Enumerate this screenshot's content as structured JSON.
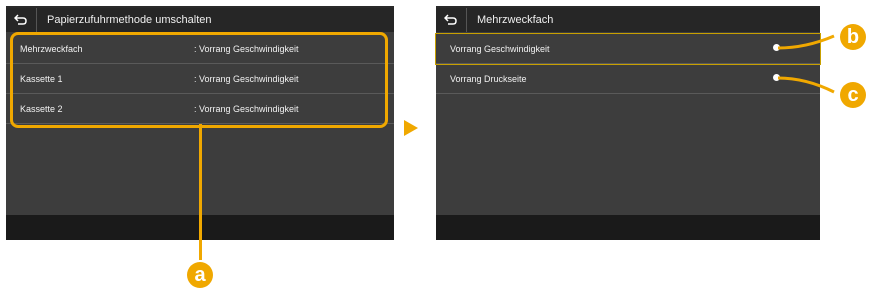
{
  "left_screen": {
    "title": "Papierzufuhrmethode umschalten",
    "rows": [
      {
        "label": "Mehrzweckfach",
        "value": ": Vorrang Geschwindigkeit"
      },
      {
        "label": "Kassette 1",
        "value": ": Vorrang Geschwindigkeit"
      },
      {
        "label": "Kassette 2",
        "value": ": Vorrang Geschwindigkeit"
      }
    ]
  },
  "right_screen": {
    "title": "Mehrzweckfach",
    "rows": [
      {
        "label": "Vorrang Geschwindigkeit"
      },
      {
        "label": "Vorrang Druckseite"
      }
    ]
  },
  "callouts": {
    "a": "a",
    "b": "b",
    "c": "c"
  },
  "colors": {
    "accent": "#f0a800",
    "screen_bg": "#3d3d3d",
    "titlebar_bg": "#262626"
  }
}
